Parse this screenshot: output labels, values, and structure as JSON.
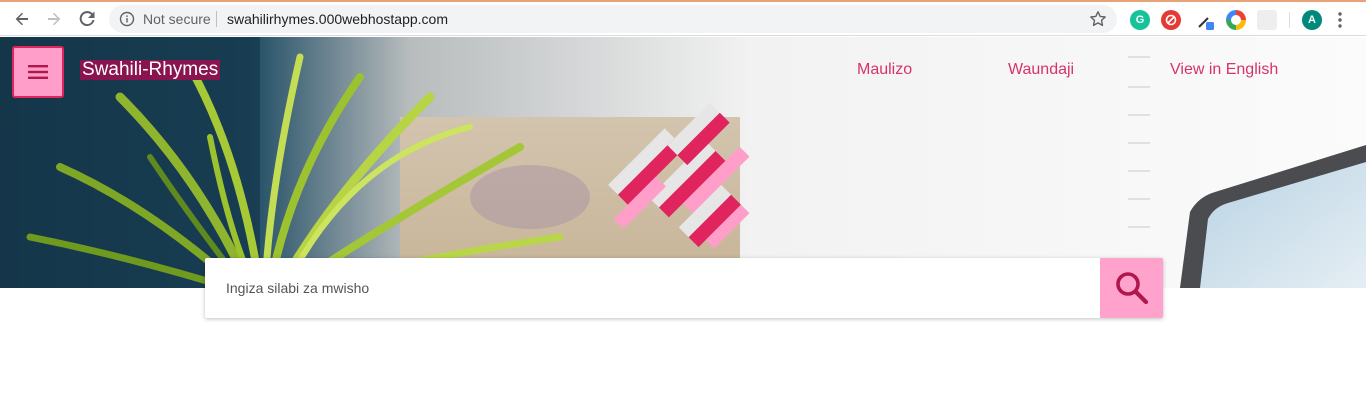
{
  "browser": {
    "security_label": "Not secure",
    "url": "swahilirhymes.000webhostapp.com",
    "profile_initial": "A",
    "extensions": [
      "grammarly-icon",
      "adblock-icon",
      "eyedropper-icon",
      "chrome-colors-icon",
      "blank-extension-icon"
    ],
    "colors": {
      "profile": "#00897b",
      "grammarly": "#15c39a",
      "adblock": "#e53935"
    }
  },
  "header": {
    "brand": "Swahili-Rhymes",
    "nav_links": [
      "Maulizo",
      "Waundaji",
      "View in English"
    ]
  },
  "search": {
    "placeholder": "Ingiza silabi za mwisho",
    "value": ""
  },
  "theme": {
    "accent": "#e0245e",
    "accent_light": "#ff9ec8",
    "link": "#d6336c"
  }
}
